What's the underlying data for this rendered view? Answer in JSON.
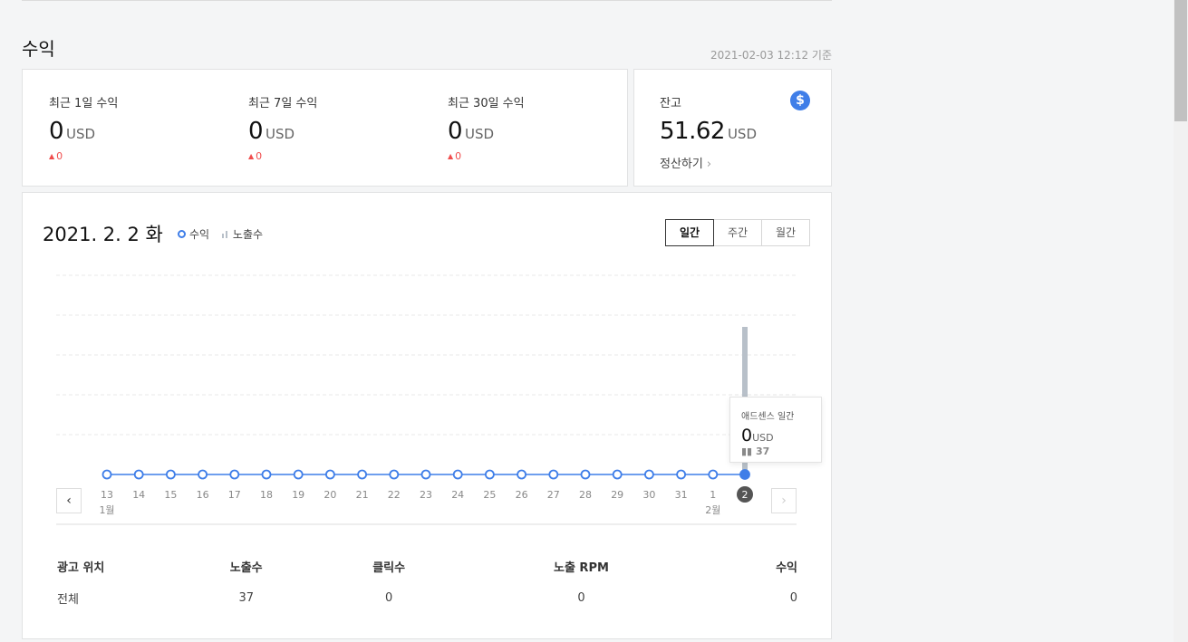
{
  "section": {
    "title": "수익",
    "as_of": "2021-02-03 12:12 기준"
  },
  "revenue_cards": [
    {
      "label": "최근 1일 수익",
      "value": "0",
      "unit": "USD",
      "delta": "0"
    },
    {
      "label": "최근 7일 수익",
      "value": "0",
      "unit": "USD",
      "delta": "0"
    },
    {
      "label": "최근 30일 수익",
      "value": "0",
      "unit": "USD",
      "delta": "0"
    }
  ],
  "balance": {
    "label": "잔고",
    "value": "51.62",
    "unit": "USD",
    "settle_label": "정산하기",
    "icon": "dollar-icon"
  },
  "chart_panel": {
    "date_title": "2021. 2. 2 화",
    "legend_revenue": "수익",
    "legend_impressions": "노출수",
    "tabs": [
      {
        "label": "일간",
        "active": true
      },
      {
        "label": "주간",
        "active": false
      },
      {
        "label": "월간",
        "active": false
      }
    ],
    "tooltip": {
      "title": "애드센스 일간",
      "value": "0",
      "unit": "USD",
      "impressions": "37"
    }
  },
  "chart_data": {
    "type": "line",
    "x": [
      "13",
      "14",
      "15",
      "16",
      "17",
      "18",
      "19",
      "20",
      "21",
      "22",
      "23",
      "24",
      "25",
      "26",
      "27",
      "28",
      "29",
      "30",
      "31",
      "1",
      "2"
    ],
    "month_labels": [
      {
        "index": 0,
        "label": "1월"
      },
      {
        "index": 19,
        "label": "2월"
      }
    ],
    "series": [
      {
        "name": "수익",
        "type": "line",
        "values": [
          0,
          0,
          0,
          0,
          0,
          0,
          0,
          0,
          0,
          0,
          0,
          0,
          0,
          0,
          0,
          0,
          0,
          0,
          0,
          0,
          0
        ]
      },
      {
        "name": "노출수",
        "type": "bar",
        "values": [
          0,
          0,
          0,
          0,
          0,
          0,
          0,
          0,
          0,
          0,
          0,
          0,
          0,
          0,
          0,
          0,
          0,
          0,
          0,
          0,
          37
        ]
      }
    ],
    "selected_index": 20,
    "colors": {
      "line": "#3f7ee8",
      "bar": "#b8c0c9",
      "selected_label_bg": "#555555"
    },
    "grid": true
  },
  "table": {
    "headers": [
      "광고 위치",
      "노출수",
      "클릭수",
      "노출 RPM",
      "수익"
    ],
    "rows": [
      [
        "전체",
        "37",
        "0",
        "0",
        "0"
      ]
    ]
  }
}
